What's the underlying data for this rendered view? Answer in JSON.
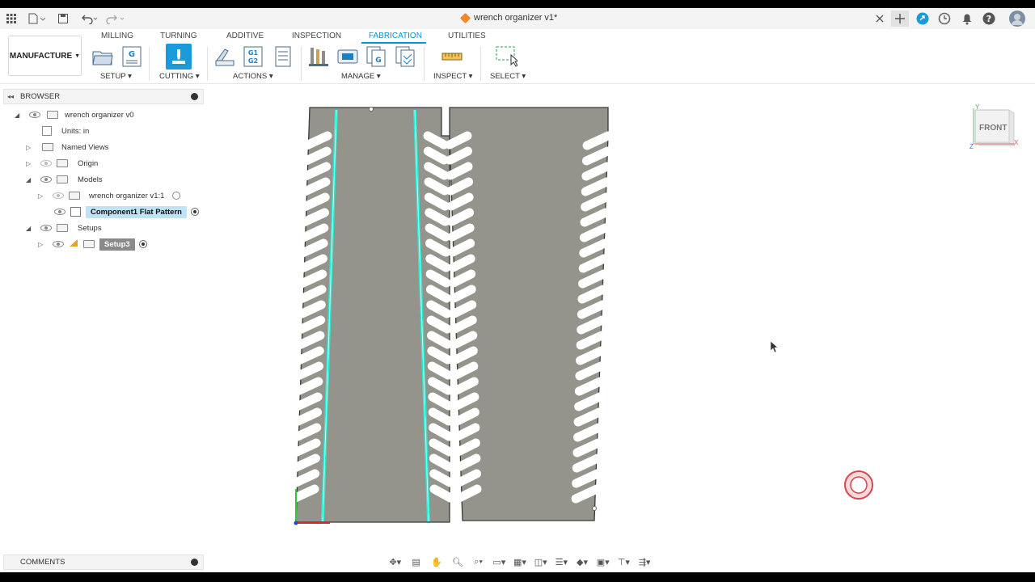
{
  "window": {
    "title": "wrench organizer v1*"
  },
  "workspace": {
    "label": "MANUFACTURE"
  },
  "tabs": [
    "MILLING",
    "TURNING",
    "ADDITIVE",
    "INSPECTION",
    "FABRICATION",
    "UTILITIES"
  ],
  "active_tab": "FABRICATION",
  "tool_groups": {
    "setup": "SETUP",
    "cutting": "CUTTING",
    "actions": "ACTIONS",
    "manage": "MANAGE",
    "inspect": "INSPECT",
    "select": "SELECT"
  },
  "browser": {
    "title": "BROWSER",
    "items": {
      "root": "wrench organizer v0",
      "units": "Units: in",
      "named_views": "Named Views",
      "origin": "Origin",
      "models": "Models",
      "model_child": "wrench organizer v1:1",
      "flat_pattern": "Component1 Flat Pattern",
      "setups": "Setups",
      "setup3": "Setup3"
    }
  },
  "comments": {
    "label": "COMMENTS"
  },
  "viewcube": {
    "face": "FRONT",
    "axis_x": "X",
    "axis_y": "Y",
    "axis_z": "Z"
  },
  "colors": {
    "accent": "#0696d7",
    "part_fill": "#94938c",
    "toolpath": "#2fe6d0",
    "workspace_orange": "#f08a24"
  },
  "icons": [
    "apps-grid-icon",
    "file-icon",
    "save-icon",
    "undo-icon",
    "redo-icon",
    "close-icon",
    "new-tab-icon",
    "extensions-icon",
    "job-status-icon",
    "notifications-icon",
    "help-icon",
    "user-avatar-icon"
  ]
}
